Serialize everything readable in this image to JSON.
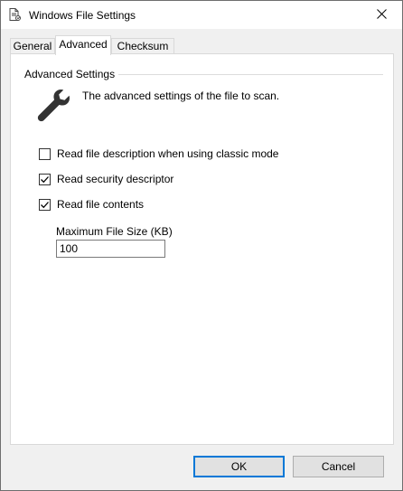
{
  "window": {
    "title": "Windows File Settings",
    "title_icon": "document-settings-icon",
    "close_icon": "close-icon"
  },
  "tabs": [
    {
      "label": "General",
      "active": false
    },
    {
      "label": "Advanced",
      "active": true
    },
    {
      "label": "Checksum",
      "active": false
    }
  ],
  "group": {
    "title": "Advanced Settings",
    "icon": "wrench-icon",
    "description": "The advanced settings of the file to scan."
  },
  "options": [
    {
      "label": "Read file description when using classic mode",
      "checked": false
    },
    {
      "label": "Read security descriptor",
      "checked": true
    },
    {
      "label": "Read file contents",
      "checked": true
    }
  ],
  "max_size": {
    "label": "Maximum File Size (KB)",
    "value": "100"
  },
  "buttons": {
    "ok": "OK",
    "cancel": "Cancel"
  },
  "colors": {
    "accent": "#0078d7",
    "window_bg": "#f0f0f0",
    "panel_bg": "#ffffff"
  }
}
